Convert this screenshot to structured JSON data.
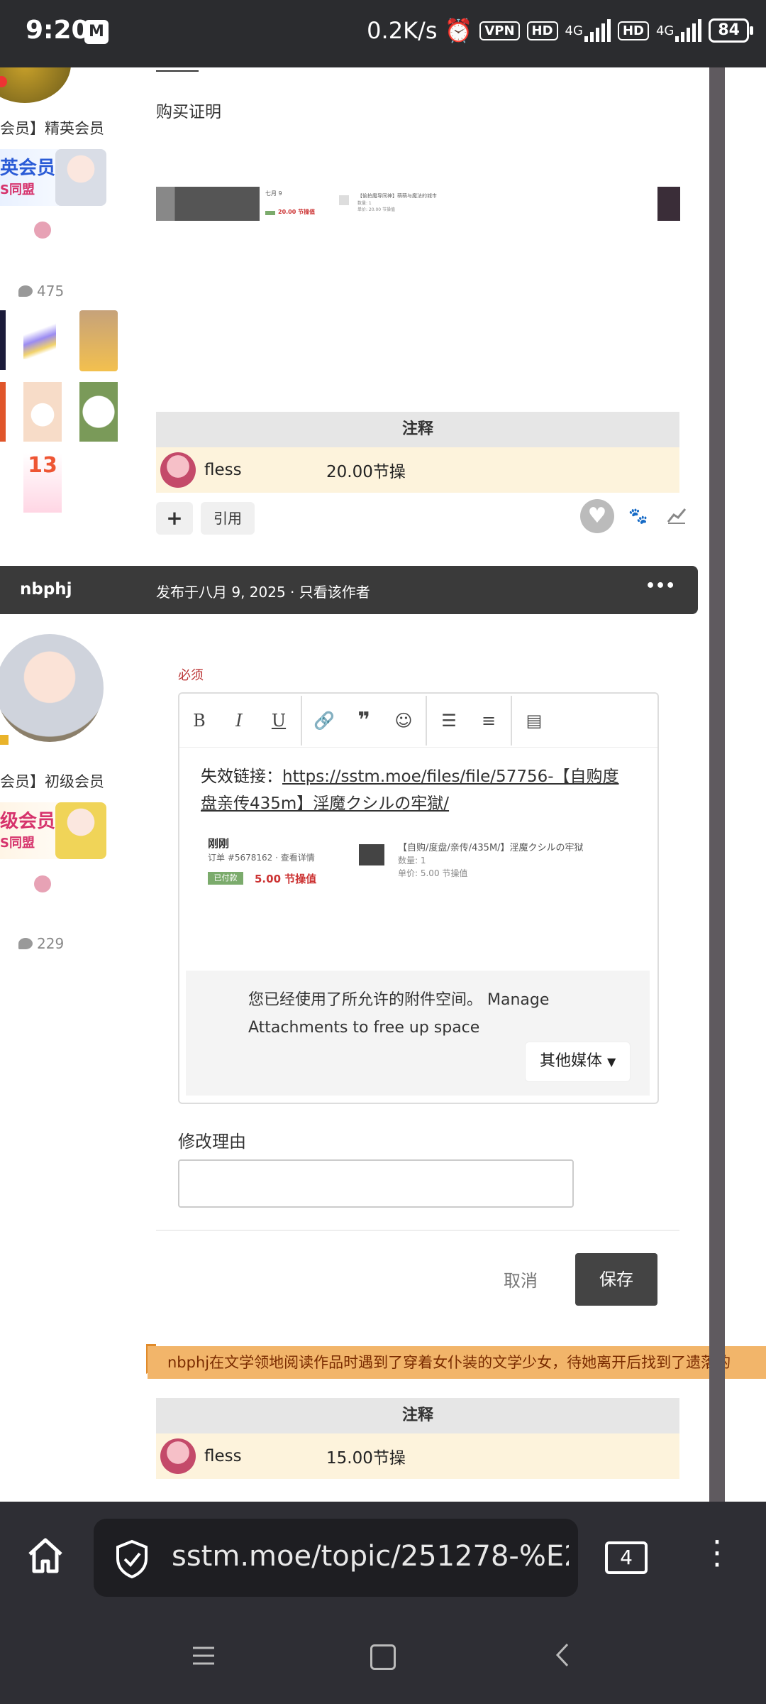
{
  "status_bar": {
    "time": "9:20",
    "net_speed": "0.2K/s",
    "vpn": "VPN",
    "hd1": "HD",
    "net1": "4G",
    "hd2": "HD",
    "net2": "4G",
    "battery": "84"
  },
  "post1": {
    "member_group": "会员】精英会员",
    "badge_text": "英会员",
    "badge_sub": "S同盟",
    "comment_count": "475",
    "proof_label": "购买证明",
    "receipt": {
      "date": "七月 9",
      "price": "20.00 节操值",
      "item": "【偷拍魔导同神】萌萌与魔法的城市",
      "qty": "数量: 1",
      "unit": "单价: 20.00 节操值"
    },
    "note_header": "注释",
    "note_user": "fless",
    "note_amount": "20.00节操",
    "add_label": "+",
    "quote_label": "引用"
  },
  "post2_bar": {
    "author": "nbphj",
    "meta": "发布于八月 9, 2025 · 只看该作者",
    "more": "•••"
  },
  "post2": {
    "member_group": "会员】初级会员",
    "badge_text": "级会员",
    "badge_sub": "S同盟",
    "comment_count": "229",
    "required_label": "必须",
    "editor": {
      "text_prefix": "失效链接：",
      "link_text": "https://sstm.moe/files/file/57756-【自购度盘亲传435m】淫魔クシルの牢獄/",
      "receipt": {
        "date": "刚刚",
        "order": "订单 #5678162 · 查看详情",
        "paid": "已付款",
        "price": "5.00 节操值",
        "item": "【自购/度盘/亲传/435M/】淫魔クシルの牢狱",
        "qty": "数量: 1",
        "unit": "单价: 5.00 节操值"
      },
      "attach_msg": "您已经使用了所允许的附件空间。 Manage Attachments to free up space",
      "other_media": "其他媒体"
    },
    "reason_label": "修改理由",
    "cancel": "取消",
    "save": "保存",
    "banner": "nbphj在文学领地阅读作品时遇到了穿着女仆装的文学少女，待她离开后找到了遗落的",
    "note_header": "注释",
    "note_user": "fless",
    "note_amount": "15.00节操"
  },
  "browser": {
    "url": "sstm.moe/topic/251278-%E2",
    "tabs": "4"
  }
}
